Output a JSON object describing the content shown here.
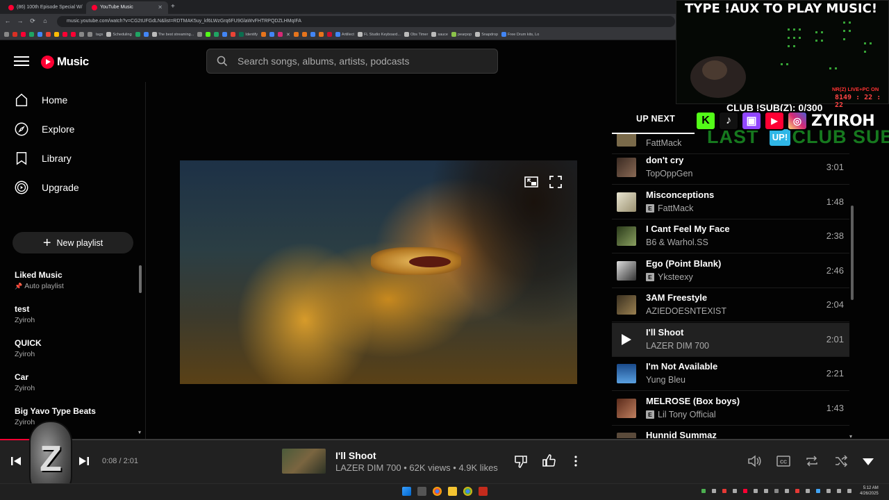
{
  "browser": {
    "tabs": [
      {
        "label": "(86) 100th Episode Special W/ T"
      },
      {
        "label": "YouTube Music"
      }
    ],
    "url": "music.youtube.com/watch?v=CG2tUFGdLN&list=RDTMAK5uy_kf6LWzGrq6FU9GlaWvFHTRPQDZLHMqIFA",
    "bookmarks": [
      "tags",
      "Scheduling",
      "The best streaming...",
      "Identify",
      "Artillect",
      "FL Studio Keyboard...",
      "Obs Timer",
      "sauce",
      "pearpop",
      "Snapdrop",
      "Free Drum kits, Lo"
    ]
  },
  "header": {
    "logo_text": "Music",
    "search_placeholder": "Search songs, albums, artists, podcasts"
  },
  "sidebar": {
    "nav": [
      {
        "label": "Home",
        "icon": "home-icon"
      },
      {
        "label": "Explore",
        "icon": "compass-icon"
      },
      {
        "label": "Library",
        "icon": "bookmark-icon"
      },
      {
        "label": "Upgrade",
        "icon": "play-circle-icon"
      }
    ],
    "new_playlist": "New playlist",
    "playlists": [
      {
        "title": "Liked Music",
        "subtitle": "Auto playlist",
        "pinned": true
      },
      {
        "title": "test",
        "subtitle": "Zyiroh"
      },
      {
        "title": "QUICK",
        "subtitle": "Zyiroh"
      },
      {
        "title": "Car",
        "subtitle": "Zyiroh"
      },
      {
        "title": "Big Yavo Type Beats",
        "subtitle": "Zyiroh"
      }
    ]
  },
  "upnext": {
    "label": "UP NEXT",
    "queue": [
      {
        "title": "",
        "artist": "FattMack",
        "duration": "",
        "explicit": false,
        "thumb": "#7a6a4a"
      },
      {
        "title": "don't cry",
        "artist": "TopOppGen",
        "duration": "3:01",
        "explicit": false,
        "thumb": "#6a5040"
      },
      {
        "title": "Misconceptions",
        "artist": "FattMack",
        "duration": "1:48",
        "explicit": true,
        "thumb": "#c8c2a8"
      },
      {
        "title": "I Cant Feel My Face",
        "artist": "B6 & Warhol.SS",
        "duration": "2:38",
        "explicit": false,
        "thumb": "#4a6a3a"
      },
      {
        "title": "Ego (Point Blank)",
        "artist": "Yksteexy",
        "duration": "2:46",
        "explicit": true,
        "thumb": "#8a8a8a"
      },
      {
        "title": "3AM Freestyle",
        "artist": "AZIEDOESNTEXIST",
        "duration": "2:04",
        "explicit": false,
        "thumb": "#6a5a3a"
      },
      {
        "title": "I'll Shoot",
        "artist": "LAZER DIM 700",
        "duration": "2:01",
        "explicit": false,
        "thumb": "#212121",
        "playing": true
      },
      {
        "title": "I'm Not Available",
        "artist": "Yung Bleu",
        "duration": "2:21",
        "explicit": false,
        "thumb": "#2a6aa8"
      },
      {
        "title": "MELROSE (Box boys)",
        "artist": "Lil Tony Official",
        "duration": "1:43",
        "explicit": true,
        "thumb": "#8a4a3a"
      },
      {
        "title": "Hunnid Summaz",
        "artist": "",
        "duration": "",
        "explicit": false,
        "thumb": "#5a4a3a"
      }
    ]
  },
  "overlay": {
    "title": "TYPE !AUX TO PLAY MUSIC!",
    "live_text": "NR(Z) LIVE+PC ON",
    "live_time": "8149 : 22 : 22",
    "sub_count": "CLUB !SUB(Z): 0/300",
    "handle": "ZYIROH",
    "last_sub": "LAST",
    "up_badge": "UP!",
    "club_sub": "CLUB SUB"
  },
  "player": {
    "time": "0:08 / 2:01",
    "progress": 0.066,
    "title": "I'll Shoot",
    "subtitle": "LAZER DIM 700 • 62K views • 4.9K likes",
    "logo_letter": "Z"
  },
  "taskbar": {
    "time": "5:12 AM",
    "date": "4/26/2025"
  }
}
